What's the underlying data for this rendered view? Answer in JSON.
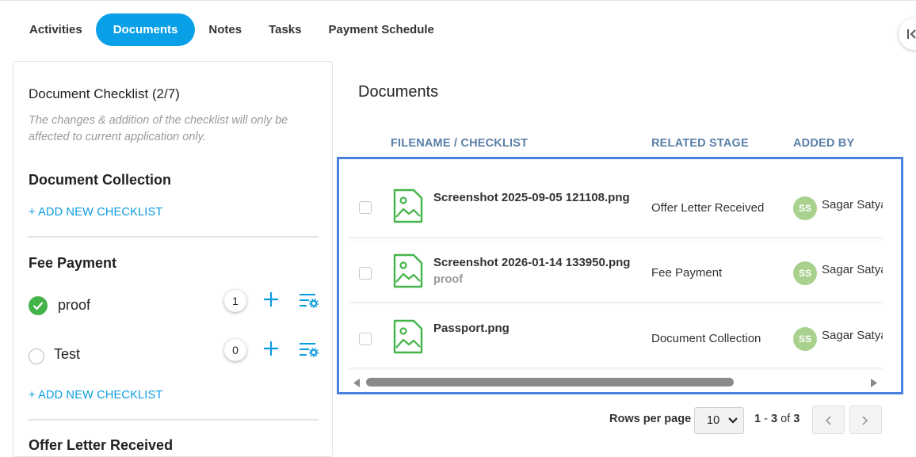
{
  "tabs": [
    {
      "label": "Activities",
      "active": false
    },
    {
      "label": "Documents",
      "active": true
    },
    {
      "label": "Notes",
      "active": false
    },
    {
      "label": "Tasks",
      "active": false
    },
    {
      "label": "Payment Schedule",
      "active": false
    }
  ],
  "checklist": {
    "title": "Document Checklist (2/7)",
    "note": "The changes & addition of the checklist will only be affected to current application only.",
    "sections": [
      {
        "title": "Document Collection",
        "add_label": "+ ADD NEW CHECKLIST",
        "items": []
      },
      {
        "title": "Fee Payment",
        "add_label": "+ ADD NEW CHECKLIST",
        "items": [
          {
            "label": "proof",
            "done": true,
            "count": "1"
          },
          {
            "label": "Test",
            "done": false,
            "count": "0"
          }
        ]
      },
      {
        "title": "Offer Letter Received"
      }
    ]
  },
  "documents": {
    "title": "Documents",
    "columns": [
      "FILENAME / CHECKLIST",
      "RELATED STAGE",
      "ADDED BY"
    ],
    "rows": [
      {
        "filename": "Screenshot 2025-09-05 121108.png",
        "checklist": "",
        "stage": "Offer Letter Received",
        "initials": "SS",
        "added_by": "Sagar Satya"
      },
      {
        "filename": "Screenshot 2026-01-14 133950.png",
        "checklist": "proof",
        "stage": "Fee Payment",
        "initials": "SS",
        "added_by": "Sagar Satya"
      },
      {
        "filename": "Passport.png",
        "checklist": "",
        "stage": "Document Collection",
        "initials": "SS",
        "added_by": "Sagar Satya"
      }
    ]
  },
  "pagination": {
    "rows_per_page_label": "Rows per page",
    "rows_per_page": "10",
    "range_start": "1",
    "range_sep": " - ",
    "range_end": "3",
    "of_label": " of ",
    "total": "3"
  },
  "colors": {
    "accent": "#0aa0e8",
    "link": "#0a9be0",
    "success": "#44b449",
    "avatar": "#a9d18e",
    "highlight": "#4a80e0",
    "header_text": "#5a7fa8"
  },
  "icons": [
    "collapse-panel-icon",
    "check-circle-icon",
    "plus-icon",
    "list-settings-icon",
    "image-file-icon",
    "scroll-left-icon",
    "scroll-right-icon",
    "chevron-down-icon",
    "chevron-left-icon",
    "chevron-right-icon"
  ]
}
